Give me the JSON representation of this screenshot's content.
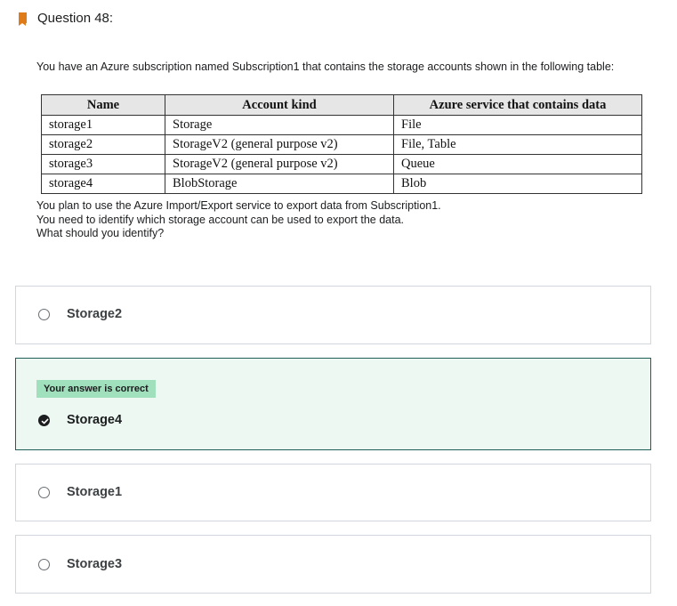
{
  "question": {
    "title": "Question 48:",
    "intro": "You have an Azure subscription named Subscription1 that contains the storage accounts shown in the following table:",
    "table": {
      "headers": [
        "Name",
        "Account kind",
        "Azure service that contains data"
      ],
      "rows": [
        [
          "storage1",
          "Storage",
          "File"
        ],
        [
          "storage2",
          "StorageV2 (general purpose v2)",
          "File, Table"
        ],
        [
          "storage3",
          "StorageV2 (general purpose v2)",
          "Queue"
        ],
        [
          "storage4",
          "BlobStorage",
          "Blob"
        ]
      ]
    },
    "lines": [
      "You plan to use the Azure Import/Export service to export data from Subscription1.",
      "You need to identify which storage account can be used to export the data.",
      "What should you identify?"
    ]
  },
  "options": [
    {
      "label": "Storage2",
      "selected": false,
      "correct": false
    },
    {
      "label": "Storage4",
      "selected": true,
      "correct": true,
      "badge": "Your answer is correct"
    },
    {
      "label": "Storage1",
      "selected": false,
      "correct": false
    },
    {
      "label": "Storage3",
      "selected": false,
      "correct": false
    }
  ],
  "colors": {
    "bookmark": "#e07b1a",
    "correct_bg": "#ecf8f1",
    "correct_border": "#1e6055",
    "badge_bg": "#a0e0bc"
  }
}
